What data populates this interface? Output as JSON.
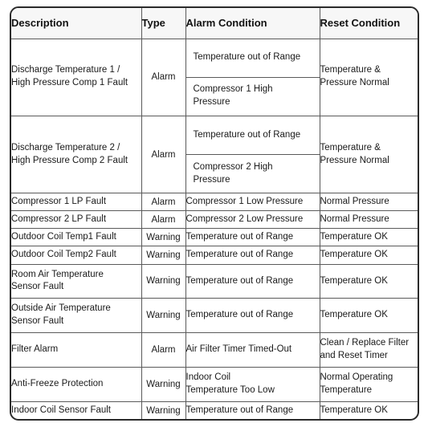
{
  "table": {
    "columns": [
      {
        "key": "description",
        "label": "Description"
      },
      {
        "key": "type",
        "label": "Type"
      },
      {
        "key": "alarm_condition",
        "label": "Alarm Condition"
      },
      {
        "key": "reset_condition",
        "label": "Reset Condition"
      }
    ],
    "rows": [
      {
        "description_lines": [
          "Discharge Temperature 1 /",
          "High Pressure Comp 1 Fault"
        ],
        "type": "Alarm",
        "alarm_condition_parts": [
          "Temperature out of Range",
          "Compressor 1 High Pressure"
        ],
        "reset_condition_lines": [
          "Temperature &",
          "Pressure Normal"
        ]
      },
      {
        "description_lines": [
          "Discharge Temperature 2 /",
          "High Pressure Comp 2 Fault"
        ],
        "type": "Alarm",
        "alarm_condition_parts": [
          "Temperature out of Range",
          "Compressor 2 High Pressure"
        ],
        "reset_condition_lines": [
          "Temperature &",
          "Pressure Normal"
        ]
      },
      {
        "description_lines": [
          "Compressor 1 LP Fault"
        ],
        "type": "Alarm",
        "alarm_condition_parts": [
          "Compressor 1 Low Pressure"
        ],
        "reset_condition_lines": [
          "Normal Pressure"
        ]
      },
      {
        "description_lines": [
          "Compressor 2 LP Fault"
        ],
        "type": "Alarm",
        "alarm_condition_parts": [
          "Compressor 2 Low Pressure"
        ],
        "reset_condition_lines": [
          "Normal Pressure"
        ]
      },
      {
        "description_lines": [
          "Outdoor Coil Temp1 Fault"
        ],
        "type": "Warning",
        "alarm_condition_parts": [
          "Temperature out of Range"
        ],
        "reset_condition_lines": [
          "Temperature OK"
        ]
      },
      {
        "description_lines": [
          "Outdoor Coil Temp2 Fault"
        ],
        "type": "Warning",
        "alarm_condition_parts": [
          "Temperature out of Range"
        ],
        "reset_condition_lines": [
          "Temperature OK"
        ]
      },
      {
        "description_lines": [
          "Room Air Temperature",
          "Sensor Fault"
        ],
        "type": "Warning",
        "alarm_condition_parts": [
          "Temperature out of Range"
        ],
        "reset_condition_lines": [
          "Temperature OK"
        ]
      },
      {
        "description_lines": [
          "Outside Air Temperature",
          "Sensor Fault"
        ],
        "type": "Warning",
        "alarm_condition_parts": [
          "Temperature out of Range"
        ],
        "reset_condition_lines": [
          "Temperature OK"
        ]
      },
      {
        "description_lines": [
          "Filter Alarm"
        ],
        "type": "Alarm",
        "alarm_condition_parts": [
          "Air Filter Timer Timed-Out"
        ],
        "reset_condition_lines": [
          "Clean / Replace Filter",
          "and Reset Timer"
        ]
      },
      {
        "description_lines": [
          "Anti-Freeze Protection"
        ],
        "type": "Warning",
        "alarm_condition_parts": [
          "Indoor Coil\nTemperature Too Low"
        ],
        "alarm_condition_lines": [
          "Indoor Coil",
          "Temperature Too Low"
        ],
        "reset_condition_lines": [
          "Normal Operating",
          "Temperature"
        ]
      },
      {
        "description_lines": [
          "Indoor Coil Sensor Fault"
        ],
        "type": "Warning",
        "alarm_condition_parts": [
          "Temperature out of Range"
        ],
        "reset_condition_lines": [
          "Temperature OK"
        ]
      }
    ]
  },
  "style": {
    "header_background": "#f7f7f7",
    "border_color": "#2b2b2b",
    "inner_border_color": "#5a5a5a",
    "text_color": "#1a1a1a",
    "page_background": "#ffffff"
  }
}
